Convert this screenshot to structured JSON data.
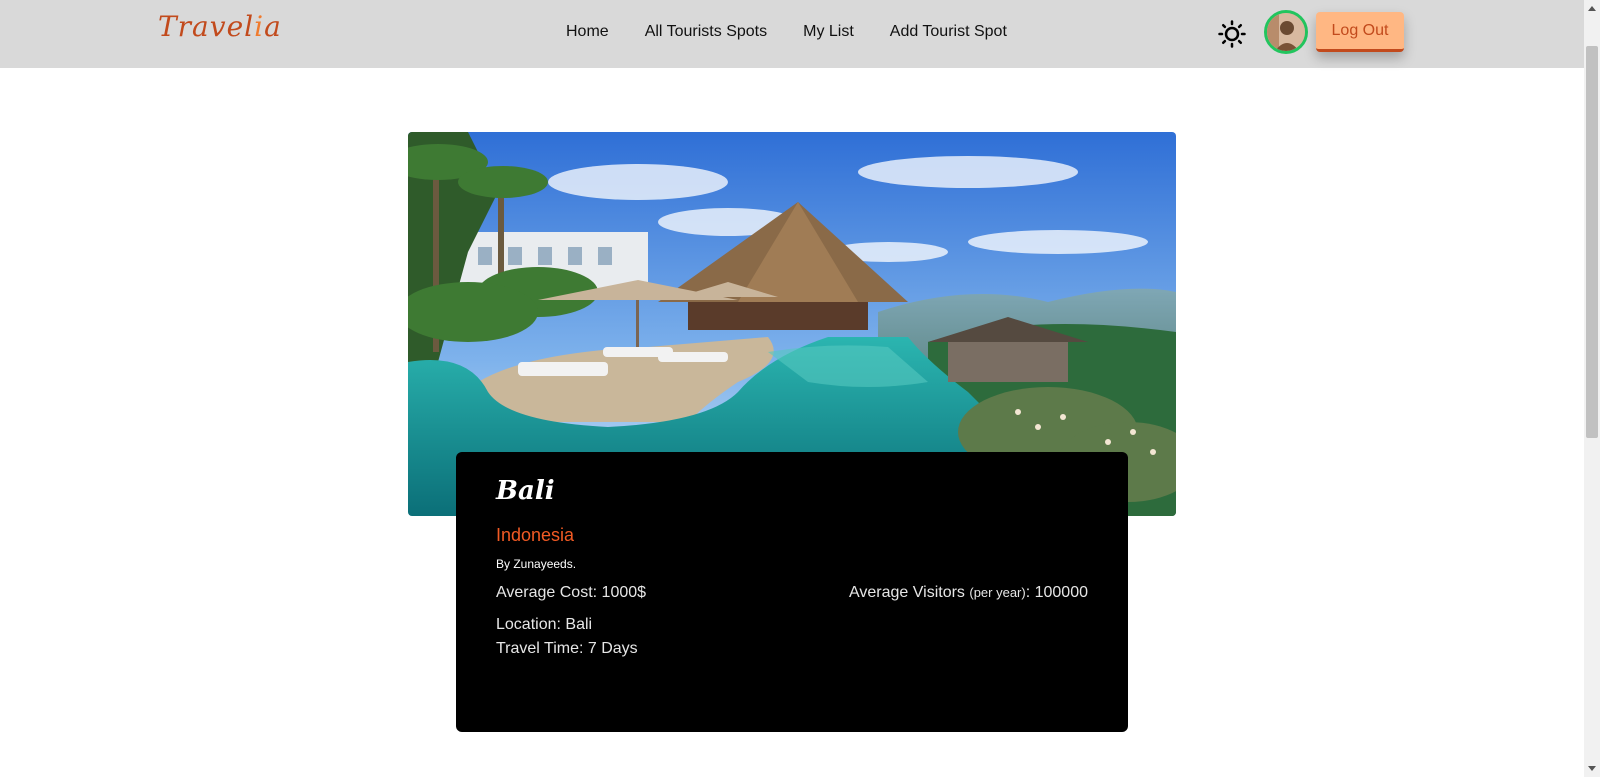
{
  "header": {
    "logo_main": "Travel",
    "logo_accent": "i",
    "logo_end": "a",
    "nav": [
      {
        "label": "Home"
      },
      {
        "label": "All Tourists Spots"
      },
      {
        "label": "My List"
      },
      {
        "label": "Add Tourist Spot"
      }
    ],
    "theme_icon": "sun-icon",
    "logout_label": "Log Out"
  },
  "spot": {
    "name": "Bali",
    "country": "Indonesia",
    "author": "By Zunayeeds.",
    "avg_cost_label": "Average Cost: ",
    "avg_cost_value": "1000$",
    "visitors_label": "Average Visitors ",
    "visitors_sub": "(per year)",
    "visitors_value": ": 100000",
    "location_label": "Location: ",
    "location_value": "Bali",
    "travel_label": "Travel Time: ",
    "travel_value": "7 Days"
  },
  "colors": {
    "brand": "#c24a1c",
    "accent": "#f15a24",
    "button_bg": "#ffb783",
    "avatar_ring": "#22c55e"
  }
}
